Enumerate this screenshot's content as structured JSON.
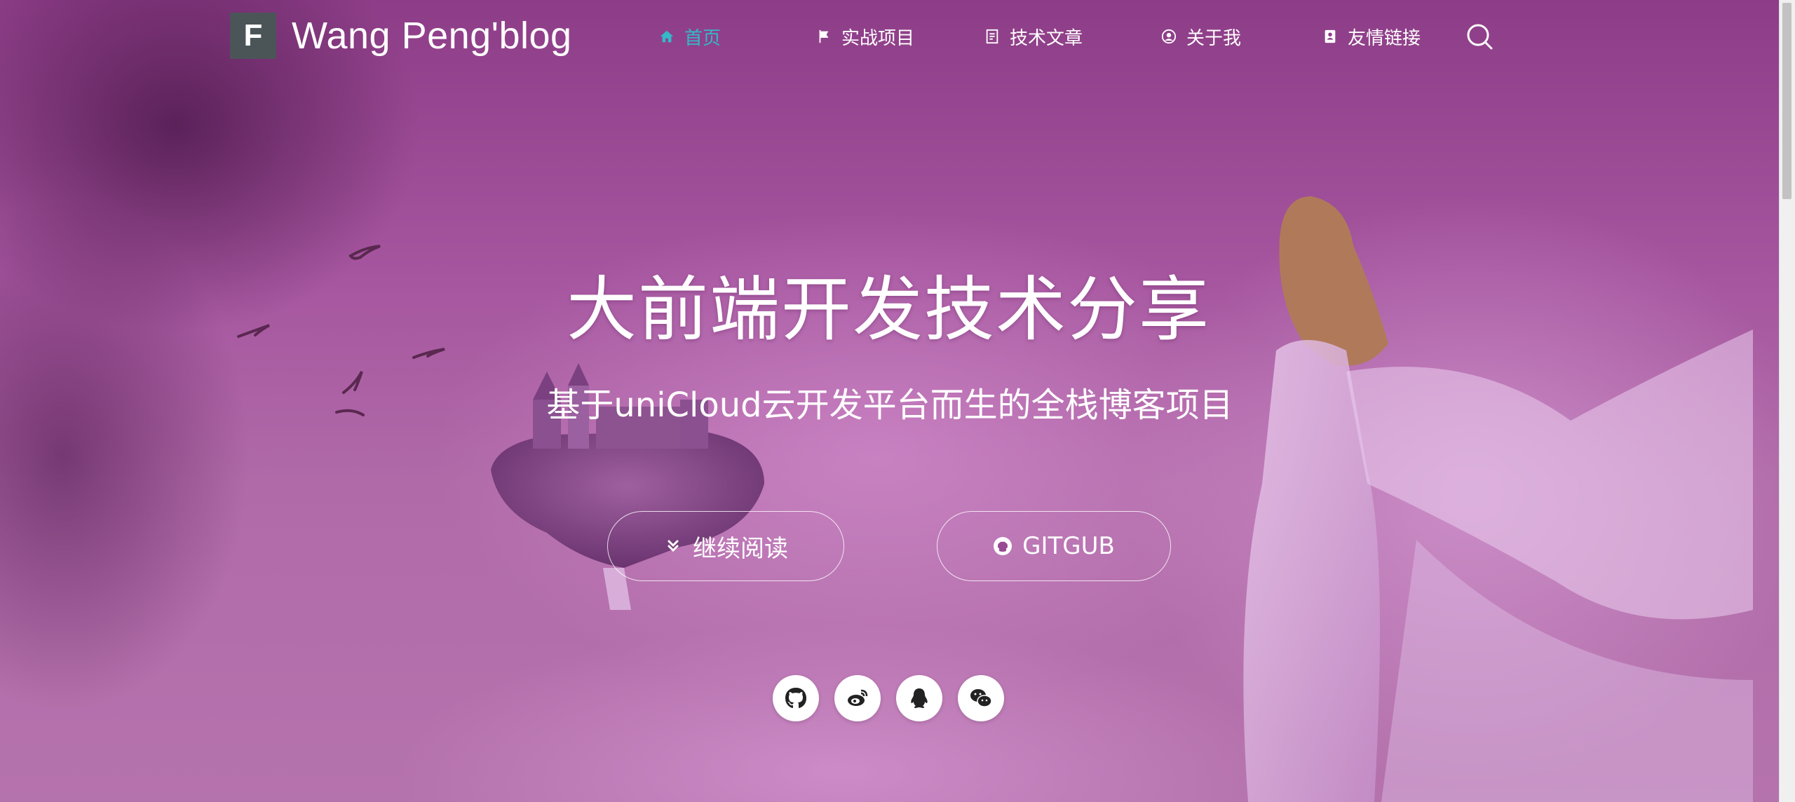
{
  "brand": {
    "logo_letter": "F",
    "name": "Wang Peng'blog"
  },
  "nav": {
    "items": [
      {
        "label": "首页",
        "icon": "home-icon",
        "active": true
      },
      {
        "label": "实战项目",
        "icon": "flag-icon",
        "active": false
      },
      {
        "label": "技术文章",
        "icon": "document-icon",
        "active": false
      },
      {
        "label": "关于我",
        "icon": "user-circle-icon",
        "active": false
      },
      {
        "label": "友情链接",
        "icon": "address-book-icon",
        "active": false
      }
    ],
    "search_icon": "search-icon",
    "active_color": "#33b9c9"
  },
  "hero": {
    "title": "大前端开发技术分享",
    "subtitle": "基于uniCloud云开发平台而生的全栈博客项目",
    "read_button": "继续阅读",
    "github_button": "GITGUB"
  },
  "socials": [
    {
      "name": "github",
      "icon": "github-icon"
    },
    {
      "name": "weibo",
      "icon": "weibo-icon"
    },
    {
      "name": "qq",
      "icon": "qq-icon"
    },
    {
      "name": "wechat",
      "icon": "wechat-icon"
    }
  ]
}
